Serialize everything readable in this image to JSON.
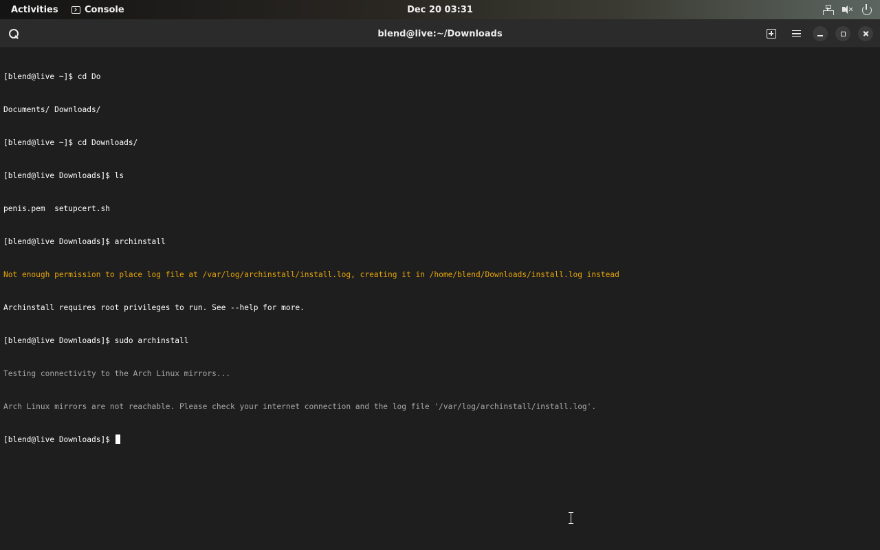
{
  "topbar": {
    "activities": "Activities",
    "app_name": "Console",
    "clock": "Dec 20  03:31",
    "tray_icons": [
      "network-icon",
      "speaker-muted-icon",
      "power-icon"
    ]
  },
  "headerbar": {
    "title": "blend@live:~/Downloads",
    "icons": [
      "search-icon",
      "new-tab-icon",
      "menu-icon",
      "minimize-icon",
      "maximize-icon",
      "close-icon"
    ]
  },
  "terminal": {
    "lines": [
      {
        "text": "[blend@live ~]$ cd Do",
        "style": "normal"
      },
      {
        "text": "Documents/ Downloads/",
        "style": "normal"
      },
      {
        "text": "[blend@live ~]$ cd Downloads/",
        "style": "normal"
      },
      {
        "text": "[blend@live Downloads]$ ls",
        "style": "normal"
      },
      {
        "text": "penis.pem  setupcert.sh",
        "style": "normal"
      },
      {
        "text": "[blend@live Downloads]$ archinstall",
        "style": "normal"
      },
      {
        "text": "Not enough permission to place log file at /var/log/archinstall/install.log, creating it in /home/blend/Downloads/install.log instead",
        "style": "warning"
      },
      {
        "text": "Archinstall requires root privileges to run. See --help for more.",
        "style": "normal"
      },
      {
        "text": "[blend@live Downloads]$ sudo archinstall",
        "style": "normal"
      },
      {
        "text": "Testing connectivity to the Arch Linux mirrors...",
        "style": "dim"
      },
      {
        "text": "Arch Linux mirrors are not reachable. Please check your internet connection and the log file '/var/log/archinstall/install.log'.",
        "style": "dim"
      }
    ],
    "prompt": "[blend@live Downloads]$ "
  },
  "colors": {
    "terminal_bg": "#1e1e1e",
    "headerbar_bg": "#2b2b2b",
    "warning": "#e5a50a",
    "dim_text": "#a8a8a8",
    "text": "#ffffff"
  }
}
